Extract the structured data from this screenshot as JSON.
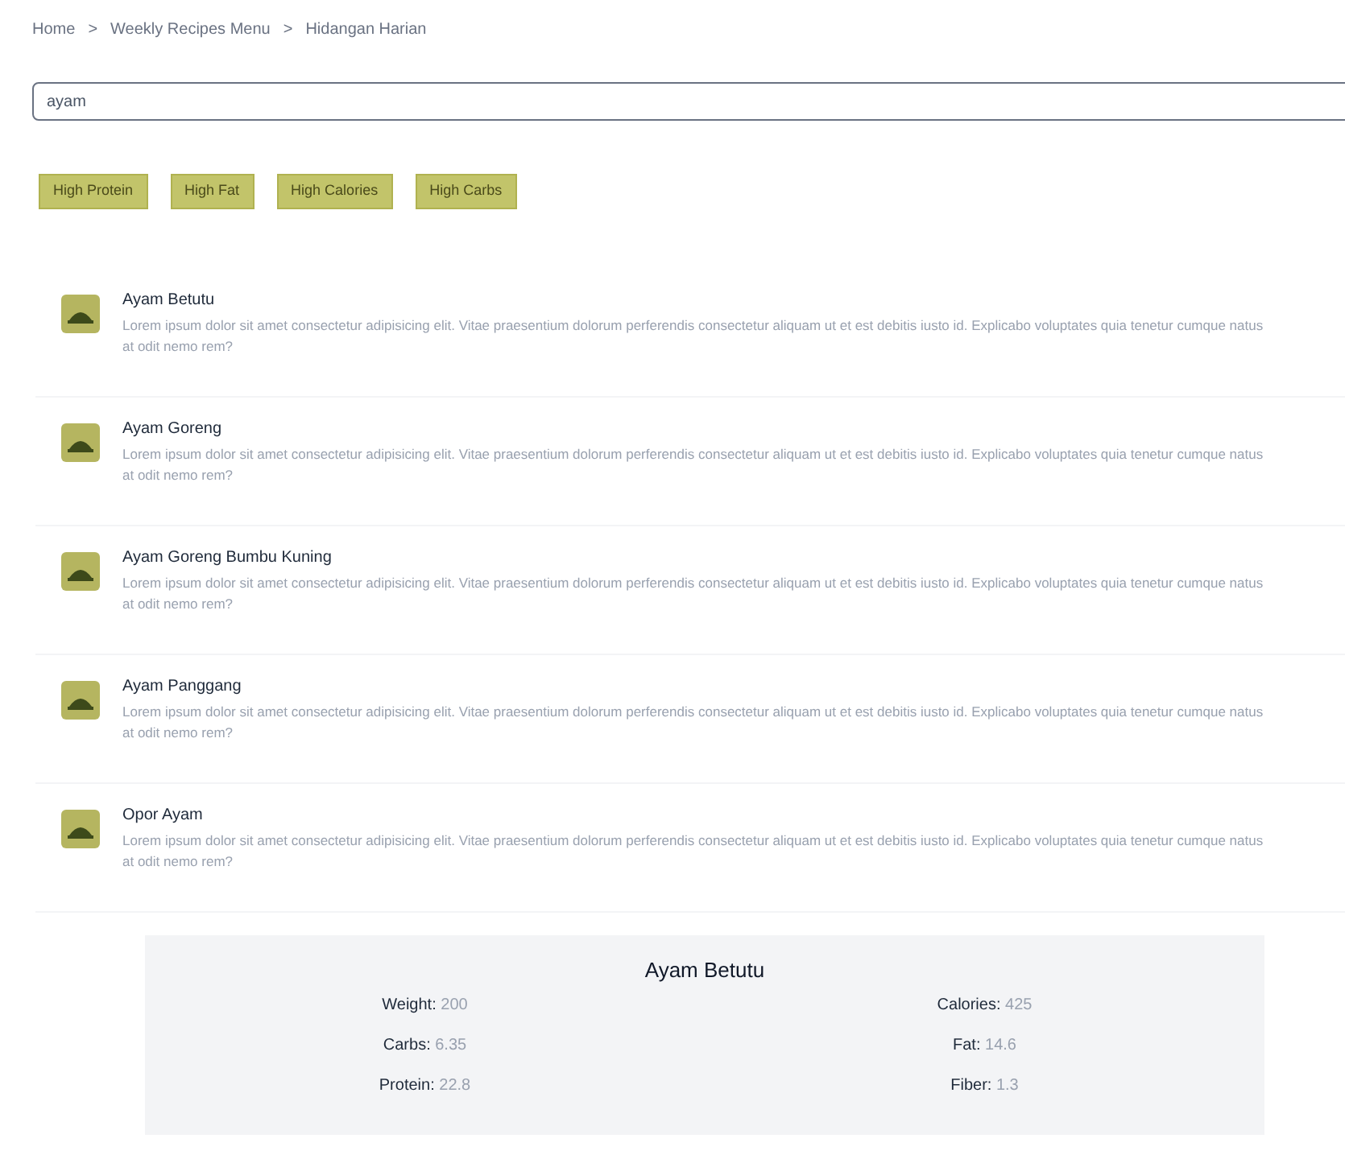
{
  "breadcrumb": [
    "Home",
    "Weekly Recipes Menu",
    "Hidangan Harian"
  ],
  "breadcrumb_separator": ">",
  "search": {
    "value": "ayam"
  },
  "filters": [
    "High Protein",
    "High Fat",
    "High Calories",
    "High Carbs"
  ],
  "recipes": [
    {
      "name": "Ayam Betutu",
      "description": "Lorem ipsum dolor sit amet consectetur adipisicing elit. Vitae praesentium dolorum perferendis consectetur aliquam ut et est debitis iusto id. Explicabo voluptates quia tenetur cumque natus at odit nemo rem?"
    },
    {
      "name": "Ayam Goreng",
      "description": "Lorem ipsum dolor sit amet consectetur adipisicing elit. Vitae praesentium dolorum perferendis consectetur aliquam ut et est debitis iusto id. Explicabo voluptates quia tenetur cumque natus at odit nemo rem?"
    },
    {
      "name": "Ayam Goreng Bumbu Kuning",
      "description": "Lorem ipsum dolor sit amet consectetur adipisicing elit. Vitae praesentium dolorum perferendis consectetur aliquam ut et est debitis iusto id. Explicabo voluptates quia tenetur cumque natus at odit nemo rem?"
    },
    {
      "name": "Ayam Panggang",
      "description": "Lorem ipsum dolor sit amet consectetur adipisicing elit. Vitae praesentium dolorum perferendis consectetur aliquam ut et est debitis iusto id. Explicabo voluptates quia tenetur cumque natus at odit nemo rem?"
    },
    {
      "name": "Opor Ayam",
      "description": "Lorem ipsum dolor sit amet consectetur adipisicing elit. Vitae praesentium dolorum perferendis consectetur aliquam ut et est debitis iusto id. Explicabo voluptates quia tenetur cumque natus at odit nemo rem?"
    }
  ],
  "detail": {
    "title": "Ayam Betutu",
    "stats": [
      {
        "label": "Weight:",
        "value": "200"
      },
      {
        "label": "Calories:",
        "value": "425"
      },
      {
        "label": "Carbs:",
        "value": "6.35"
      },
      {
        "label": "Fat:",
        "value": "14.6"
      },
      {
        "label": "Protein:",
        "value": "22.8"
      },
      {
        "label": "Fiber:",
        "value": "1.3"
      }
    ]
  }
}
